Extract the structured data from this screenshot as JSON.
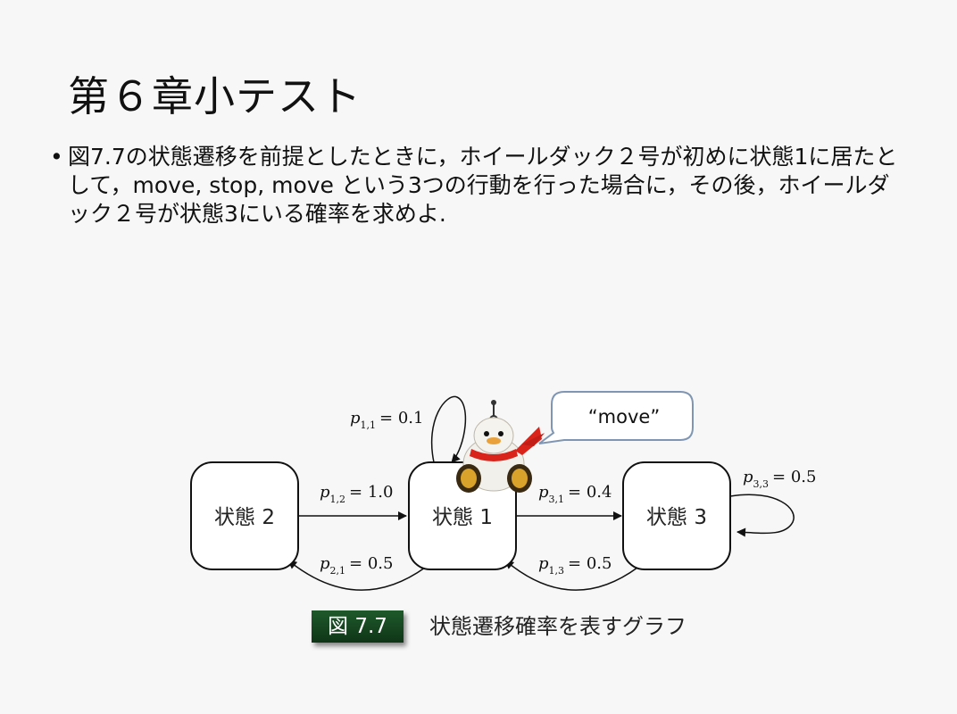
{
  "slide": {
    "title": "第６章小テスト",
    "bullet_marker": "•",
    "bullet_text": "図7.7の状態遷移を前提としたときに，ホイールダック２号が初めに状態1に居たとして，move, stop, move という3つの行動を行った場合に，その後，ホイールダック２号が状態3にいる確率を求めよ."
  },
  "figure": {
    "states": [
      {
        "id": "s2",
        "label": "状態 2"
      },
      {
        "id": "s1",
        "label": "状態 1"
      },
      {
        "id": "s3",
        "label": "状態 3"
      }
    ],
    "transitions": [
      {
        "p": "p",
        "sub": "1,1",
        "value": "= 0.1"
      },
      {
        "p": "p",
        "sub": "1,2",
        "value": "= 1.0"
      },
      {
        "p": "p",
        "sub": "2,1",
        "value": "= 0.5"
      },
      {
        "p": "p",
        "sub": "3,1",
        "value": "= 0.4"
      },
      {
        "p": "p",
        "sub": "1,3",
        "value": "= 0.5"
      },
      {
        "p": "p",
        "sub": "3,3",
        "value": "= 0.5"
      }
    ],
    "speech_bubble": "“move”",
    "caption_number": "図 7.7",
    "caption_text": "状態遷移確率を表すグラフ",
    "colors": {
      "badge": "#1a4d25",
      "robot_scarf": "#d9241c",
      "bubble_border": "#7f96b3"
    }
  }
}
